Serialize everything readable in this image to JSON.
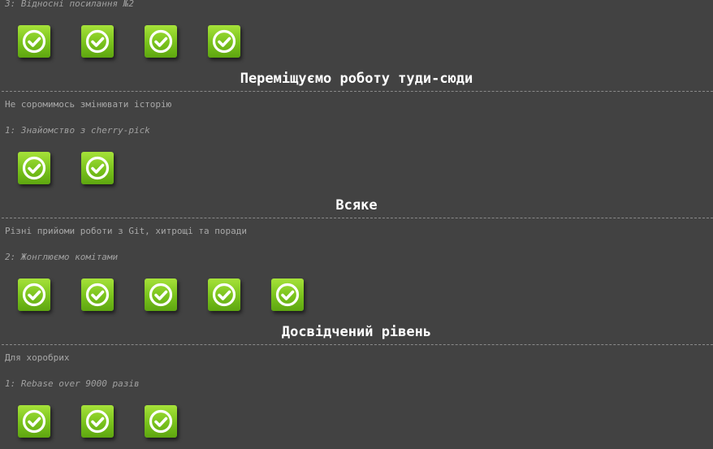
{
  "sections": [
    {
      "title": "",
      "description": "",
      "level_label": "3: Відносні посилання №2",
      "levels": [
        {
          "state": "completed",
          "icon": "check-circle-icon"
        },
        {
          "state": "completed",
          "icon": "check-circle-icon"
        },
        {
          "state": "completed",
          "icon": "check-circle-icon"
        },
        {
          "state": "completed",
          "icon": "check-circle-icon"
        }
      ]
    },
    {
      "title": "Переміщуємо роботу туди-сюди",
      "description": "Не соромимось змінювати історію",
      "level_label": "1: Знайомство з cherry-pick",
      "levels": [
        {
          "state": "completed",
          "icon": "check-circle-icon"
        },
        {
          "state": "completed",
          "icon": "check-circle-icon"
        }
      ]
    },
    {
      "title": "Всяке",
      "description": "Різні прийоми роботи з Git, хитрощі та поради",
      "level_label": "2: Жонглюємо комітами",
      "levels": [
        {
          "state": "completed",
          "icon": "check-circle-icon"
        },
        {
          "state": "completed",
          "icon": "check-circle-icon"
        },
        {
          "state": "completed",
          "icon": "check-circle-icon"
        },
        {
          "state": "completed",
          "icon": "check-circle-icon"
        },
        {
          "state": "completed",
          "icon": "check-circle-icon"
        }
      ]
    },
    {
      "title": "Досвідчений рівень",
      "description": "Для хоробрих",
      "level_label": "1: Rebase over 9000 разів",
      "levels": [
        {
          "state": "completed",
          "icon": "check-circle-icon"
        },
        {
          "state": "completed",
          "icon": "check-circle-icon"
        },
        {
          "state": "completed",
          "icon": "check-circle-icon"
        }
      ]
    }
  ],
  "colors": {
    "background": "#424242",
    "button_green": "#79c21c",
    "title_text": "#ffffff",
    "muted_text": "#a8a8a8"
  }
}
